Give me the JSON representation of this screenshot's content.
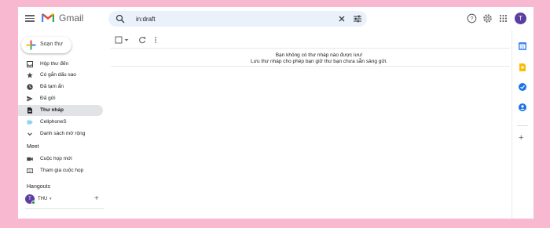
{
  "header": {
    "app_name": "Gmail",
    "search_value": "in:draft",
    "avatar_letter": "T"
  },
  "sidebar": {
    "compose_label": "Soạn thư",
    "items": [
      {
        "label": "Hộp thư đến",
        "icon": "inbox-icon",
        "active": false
      },
      {
        "label": "Có gắn dấu sao",
        "icon": "star-icon",
        "active": false
      },
      {
        "label": "Đã tạm ẩn",
        "icon": "clock-icon",
        "active": false
      },
      {
        "label": "Đã gửi",
        "icon": "send-icon",
        "active": false
      },
      {
        "label": "Thư nháp",
        "icon": "draft-icon",
        "active": true
      },
      {
        "label": "CellphoneS",
        "icon": "label-icon",
        "active": false
      },
      {
        "label": "Danh sách mở rộng",
        "icon": "chevron-down-icon",
        "active": false
      }
    ],
    "meet": {
      "title": "Meet",
      "items": [
        {
          "label": "Cuộc họp mới",
          "icon": "video-icon"
        },
        {
          "label": "Tham gia cuộc họp",
          "icon": "keyboard-icon"
        }
      ]
    },
    "hangouts": {
      "title": "Hangouts",
      "user_initial": "T",
      "user_name": "THU",
      "caret": "▾",
      "add": "+"
    }
  },
  "main": {
    "empty_line1": "Bạn không có thư nháp nào được lưu!",
    "empty_line2": "Lưu thư nháp cho phép bạn giữ thư bạn chưa sẵn sàng gửi."
  },
  "rail": {
    "add": "+"
  },
  "colors": {
    "background": "#f8b8cf",
    "accent": "#5b3fa0",
    "active_nav": "#e1e3e6",
    "search_bg": "#eaf1fb"
  }
}
